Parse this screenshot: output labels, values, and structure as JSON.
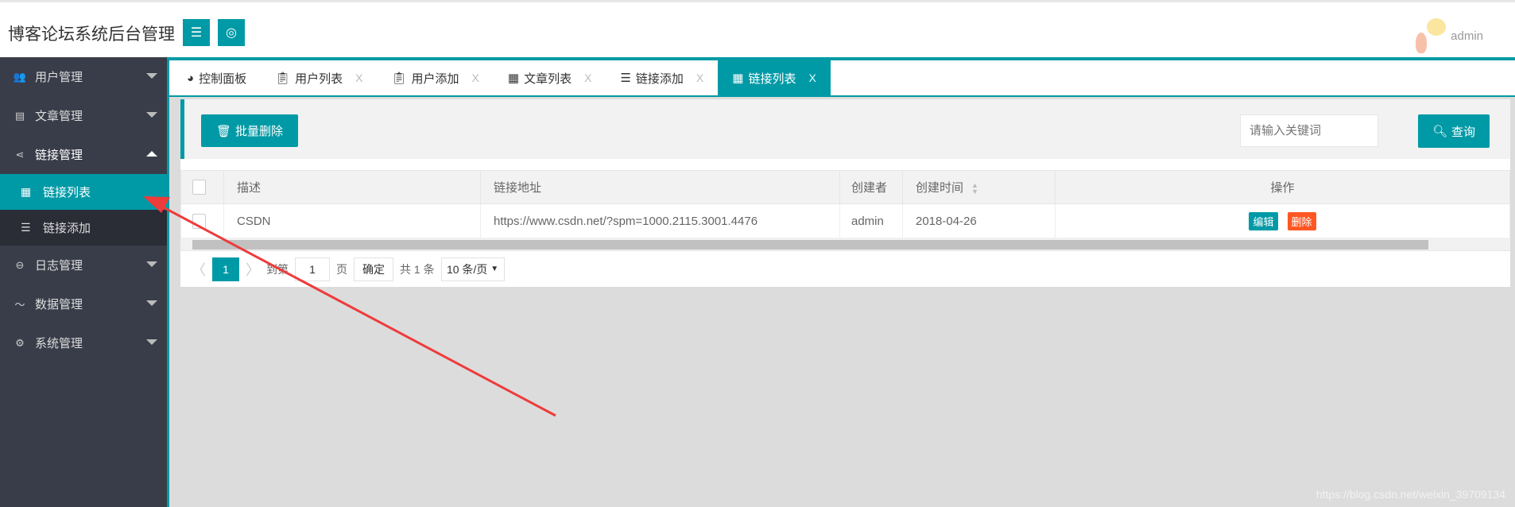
{
  "header": {
    "title": "博客论坛系统后台管理",
    "user": "admin"
  },
  "sidebar": {
    "groups": [
      {
        "label": "用户管理",
        "icon": "users-icon"
      },
      {
        "label": "文章管理",
        "icon": "document-icon"
      },
      {
        "label": "链接管理",
        "icon": "share-icon",
        "children": [
          {
            "label": "链接列表",
            "active": true
          },
          {
            "label": "链接添加"
          }
        ]
      },
      {
        "label": "日志管理",
        "icon": "log-icon"
      },
      {
        "label": "数据管理",
        "icon": "pulse-icon"
      },
      {
        "label": "系统管理",
        "icon": "gears-icon"
      }
    ]
  },
  "tabs": [
    {
      "label": "控制面板"
    },
    {
      "label": "用户列表"
    },
    {
      "label": "用户添加"
    },
    {
      "label": "文章列表"
    },
    {
      "label": "链接添加"
    },
    {
      "label": "链接列表",
      "active": true
    }
  ],
  "tab_close": "X",
  "toolbar": {
    "batch_delete": "批量删除",
    "search_placeholder": "请输入关键词",
    "query": "查询"
  },
  "table": {
    "headers": [
      "描述",
      "链接地址",
      "创建者",
      "创建时间",
      "操作"
    ],
    "rows": [
      {
        "desc": "CSDN",
        "url": "https://www.csdn.net/?spm=1000.2115.3001.4476",
        "creator": "admin",
        "created": "2018-04-26",
        "edit": "编辑",
        "delete": "删除"
      }
    ]
  },
  "pager": {
    "current": "1",
    "goto_label": "到第",
    "goto_value": "1",
    "page_unit": "页",
    "confirm": "确定",
    "total": "共 1 条",
    "page_size": "10 条/页"
  },
  "watermark": "https://blog.csdn.net/weixin_39709134",
  "colors": {
    "accent": "#009aa6",
    "danger": "#ff5722",
    "sidebar": "#393d49"
  }
}
